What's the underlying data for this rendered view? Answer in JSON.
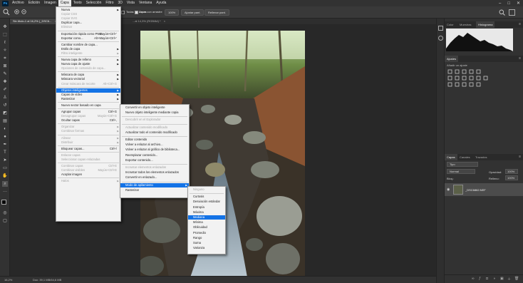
{
  "menubar": {
    "logo": "Ps",
    "items": [
      "Archivo",
      "Edición",
      "Imagen",
      "Capa",
      "Texto",
      "Selección",
      "Filtro",
      "3D",
      "Vista",
      "Ventana",
      "Ayuda"
    ],
    "window_controls": [
      "–",
      "□",
      "✕"
    ]
  },
  "options": {
    "layers_label": "Todas las capas",
    "fill_canvas_label": "Ajustar al lienzo",
    "scrubby_label": "Zoom con arrastre",
    "zoom_value": "100%",
    "fit_screen": "Ajustar pant.",
    "fill_screen": "Rellenar pant."
  },
  "document": {
    "active_tab": "Sin título-1 al 16,2% (_DSC6...",
    "inactive_tab": "...al 14,3% (RGB/8#) *"
  },
  "status": {
    "zoom": "16,2%",
    "doc": "Doc: 39,1 MB/64,6 MB"
  },
  "panels": {
    "top_tabs": [
      "Color",
      "Muestras",
      "Histograma"
    ],
    "adjust_tab": "Ajustes",
    "adjust_hint": "Añadir un ajuste",
    "layer_tabs": [
      "Capas",
      "Canales",
      "Trazados"
    ],
    "kind_label": "Tipo",
    "blend_mode": "Normal",
    "opacity_label": "Opacidad:",
    "opacity_value": "100%",
    "lock_label": "Bloq.:",
    "fill_label": "Relleno:",
    "fill_value": "100%",
    "layer_name": "_DSC6862.NEF"
  },
  "menu_capa": [
    {
      "label": "Nueva",
      "arrow": true
    },
    {
      "label": "Copiar CSS",
      "disabled": true
    },
    {
      "label": "Copiar SVG",
      "disabled": true
    },
    {
      "label": "Duplicar capa..."
    },
    {
      "label": "Eliminar",
      "disabled": true
    },
    {
      "sep": true
    },
    {
      "label": "Exportación rápida como PNG",
      "shortcut": "Mayús+Ctrl+'"
    },
    {
      "label": "Exportar como...",
      "shortcut": "Alt+Mayús+Ctrl+'"
    },
    {
      "sep": true
    },
    {
      "label": "Cambiar nombre de capa..."
    },
    {
      "label": "Estilo de capa",
      "arrow": true
    },
    {
      "label": "Filtro inteligente",
      "arrow": true,
      "disabled": true
    },
    {
      "sep": true
    },
    {
      "label": "Nueva capa de relleno",
      "arrow": true
    },
    {
      "label": "Nueva capa de ajuste",
      "arrow": true
    },
    {
      "label": "Opciones de contenido de capa...",
      "disabled": true
    },
    {
      "sep": true
    },
    {
      "label": "Máscara de capa",
      "arrow": true
    },
    {
      "label": "Máscara vectorial",
      "arrow": true
    },
    {
      "label": "Crear máscara de recorte",
      "shortcut": "Alt+Ctrl+G",
      "disabled": true
    },
    {
      "sep": true
    },
    {
      "label": "Objetos inteligentes",
      "arrow": true,
      "highlight": true
    },
    {
      "label": "Capas de vídeo",
      "arrow": true
    },
    {
      "label": "Rasterizar",
      "arrow": true
    },
    {
      "sep": true
    },
    {
      "label": "Nuevo sector basado en capa"
    },
    {
      "sep": true
    },
    {
      "label": "Agrupar capas",
      "shortcut": "Ctrl+G"
    },
    {
      "label": "Desagrupar capas",
      "shortcut": "Mayús+Ctrl+G",
      "disabled": true
    },
    {
      "label": "Ocultar capas",
      "shortcut": "Ctrl+,"
    },
    {
      "sep": true
    },
    {
      "label": "Organizar",
      "arrow": true,
      "disabled": true
    },
    {
      "label": "Combinar formas",
      "arrow": true,
      "disabled": true
    },
    {
      "sep": true
    },
    {
      "label": "Alinear",
      "arrow": true,
      "disabled": true
    },
    {
      "label": "Distribuir",
      "arrow": true,
      "disabled": true
    },
    {
      "sep": true
    },
    {
      "label": "Bloquear capas...",
      "shortcut": "Ctrl+/"
    },
    {
      "sep": true
    },
    {
      "label": "Enlazar capas",
      "disabled": true
    },
    {
      "label": "Seleccionar capas enlazadas",
      "disabled": true
    },
    {
      "sep": true
    },
    {
      "label": "Combinar capas",
      "shortcut": "Ctrl+E",
      "disabled": true
    },
    {
      "label": "Combinar visibles",
      "shortcut": "Mayús+Ctrl+E",
      "disabled": true
    },
    {
      "label": "Acoplar imagen"
    },
    {
      "sep": true
    },
    {
      "label": "Halos",
      "arrow": true,
      "disabled": true
    }
  ],
  "menu_objetos": [
    {
      "label": "Convertir en objeto inteligente"
    },
    {
      "label": "Nuevo objeto inteligente mediante copia"
    },
    {
      "sep": true
    },
    {
      "label": "Descubrir en el Explorador",
      "disabled": true
    },
    {
      "sep": true
    },
    {
      "label": "Actualizar contenido modificado",
      "disabled": true
    },
    {
      "label": "Actualizar todo el contenido modificado"
    },
    {
      "sep": true
    },
    {
      "label": "Editar contenido"
    },
    {
      "label": "Volver a enlazar al archivo..."
    },
    {
      "label": "Volver a enlazar al gráfico de biblioteca..."
    },
    {
      "label": "Reemplazar contenido..."
    },
    {
      "label": "Exportar contenido..."
    },
    {
      "sep": true
    },
    {
      "label": "Incrustar elementos enlazados",
      "disabled": true
    },
    {
      "label": "Incrustar todos los elementos enlazados"
    },
    {
      "label": "Convertir en enlazado..."
    },
    {
      "sep": true
    },
    {
      "label": "Modo de apilamiento",
      "arrow": true,
      "highlight": true
    },
    {
      "label": "Rasterizar"
    }
  ],
  "menu_apilamiento": [
    {
      "label": "Ninguno",
      "disabled": true
    },
    {
      "sep": true
    },
    {
      "label": "Curtosis"
    },
    {
      "label": "Desviación estándar"
    },
    {
      "label": "Entropía"
    },
    {
      "label": "Máxima"
    },
    {
      "label": "Mediana",
      "highlight": true
    },
    {
      "label": "Mínima"
    },
    {
      "label": "Oblicuidad"
    },
    {
      "label": "Promedio"
    },
    {
      "label": "Rango"
    },
    {
      "label": "Suma"
    },
    {
      "label": "Varianza"
    }
  ],
  "colors": {
    "highlight": "#1473e6",
    "menu_bg": "#f2f2f2",
    "app_bg": "#282828"
  }
}
